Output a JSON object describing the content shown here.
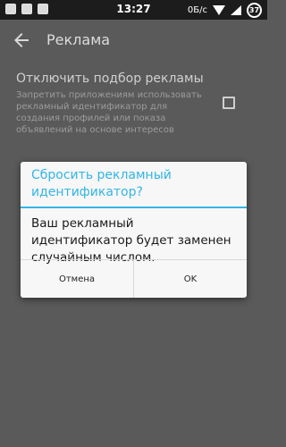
{
  "status_bar": {
    "time": "13:27",
    "data_speed": "0Б/с",
    "battery": "37",
    "icons": [
      "image-notification-icon",
      "download-notification-icon",
      "bag-notification-icon",
      "wifi-icon",
      "signal-icon",
      "battery-icon"
    ]
  },
  "app_bar": {
    "title": "Реклама",
    "back_icon": "back-arrow-icon"
  },
  "setting": {
    "title": "Отключить подбор рекламы",
    "description": "Запретить приложениям использовать рекламный идентификатор для создания профилей или показа объявлений на основе интересов",
    "checked": false
  },
  "dialog": {
    "title": "Сбросить рекламный идентификатор?",
    "message": "Ваш рекламный идентификатор будет заменен случайным числом.",
    "cancel_label": "Отмена",
    "ok_label": "OK"
  },
  "colors": {
    "accent": "#33b5e5",
    "background_dimmed": "#5a5a5a",
    "dialog_bg": "#f7f7f7"
  }
}
